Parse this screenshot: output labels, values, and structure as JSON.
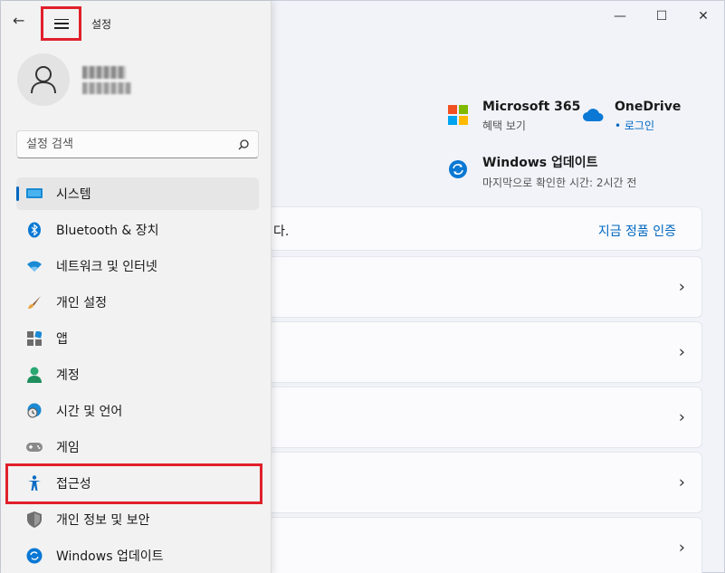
{
  "window": {
    "title": "설정",
    "controls": {
      "minimize": "—",
      "maximize": "☐",
      "close": "✕"
    }
  },
  "user": {
    "avatar_icon": "person-icon"
  },
  "search": {
    "placeholder": "설정 검색"
  },
  "nav": {
    "items": [
      {
        "label": "시스템",
        "icon": "system-icon",
        "selected": true
      },
      {
        "label": "Bluetooth & 장치",
        "icon": "bluetooth-icon"
      },
      {
        "label": "네트워크 및 인터넷",
        "icon": "wifi-icon"
      },
      {
        "label": "개인 설정",
        "icon": "brush-icon"
      },
      {
        "label": "앱",
        "icon": "apps-icon"
      },
      {
        "label": "계정",
        "icon": "account-icon"
      },
      {
        "label": "시간 및 언어",
        "icon": "time-language-icon"
      },
      {
        "label": "게임",
        "icon": "gamepad-icon"
      },
      {
        "label": "접근성",
        "icon": "accessibility-icon"
      },
      {
        "label": "개인 정보 및 보안",
        "icon": "shield-icon"
      },
      {
        "label": "Windows 업데이트",
        "icon": "update-icon"
      }
    ]
  },
  "main": {
    "ms365": {
      "title": "Microsoft 365",
      "sub": "혜택 보기"
    },
    "onedrive": {
      "title": "OneDrive",
      "sub": "• 로그인"
    },
    "winupdate": {
      "title": "Windows 업데이트",
      "sub": "마지막으로 확인한 시간: 2시간 전"
    },
    "activation": {
      "text": "다.",
      "link": "지금 정품 인증"
    },
    "cards": [
      {},
      {},
      {},
      {},
      {}
    ]
  },
  "colors": {
    "accent": "#0067c0",
    "annotation": "#e0202b"
  }
}
